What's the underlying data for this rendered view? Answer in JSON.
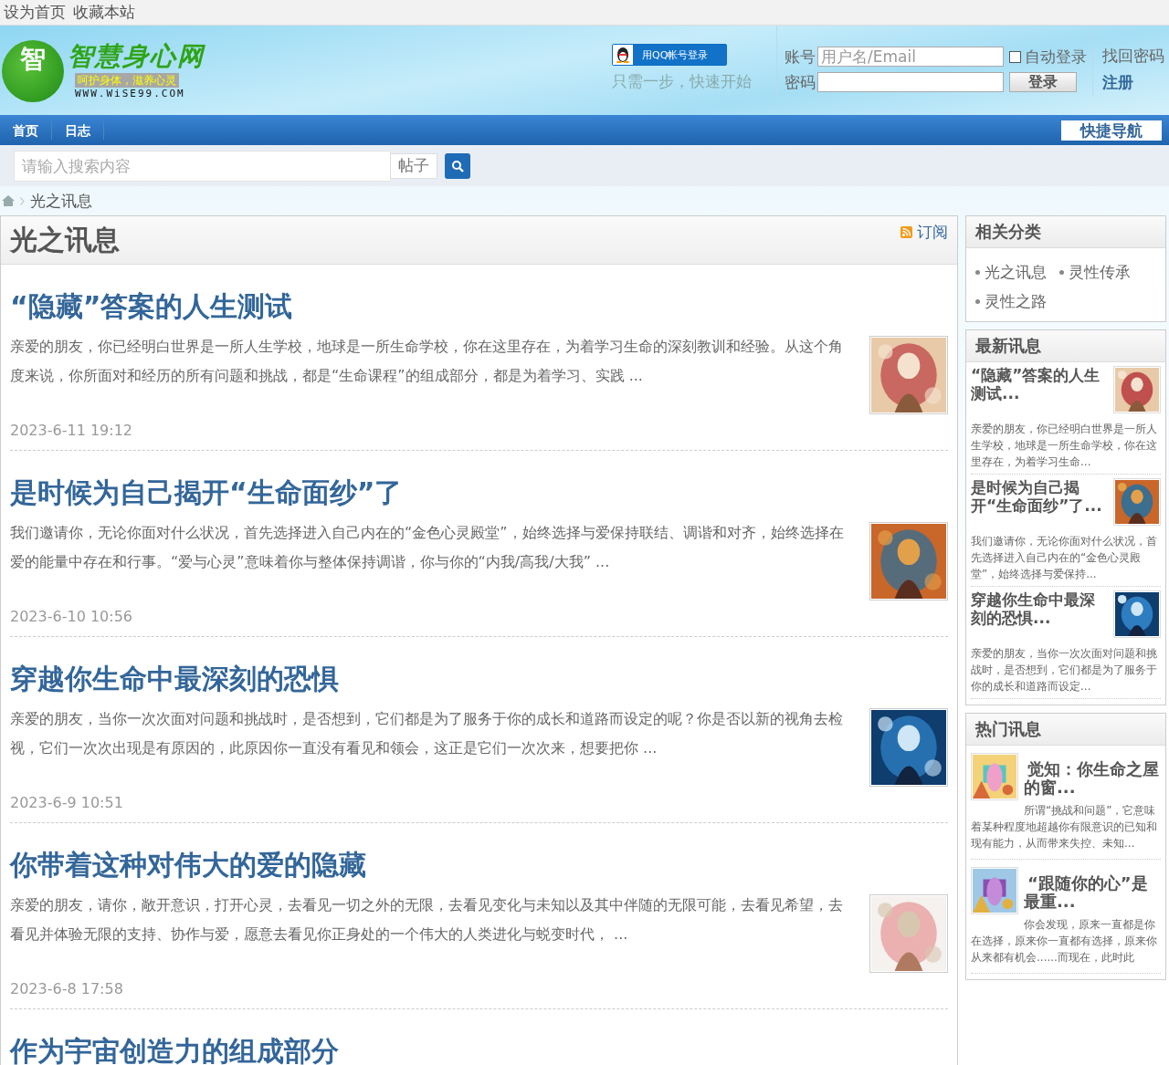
{
  "top_links": [
    "设为首页",
    "收藏本站"
  ],
  "logo": {
    "mark": "智",
    "name": "智慧身心网",
    "slogan": "呵护身体，滋养心灵",
    "url": "WWW.WiSE99.COM"
  },
  "qq_login": {
    "button": "用QQ帐号登录",
    "hint": "只需一步，快速开始"
  },
  "login": {
    "account_label": "账号",
    "account_placeholder": "用户名/Email",
    "password_label": "密码",
    "auto_login": "自动登录",
    "auto_login_checked": false,
    "submit": "登录",
    "forgot": "找回密码",
    "register": "注册"
  },
  "nav": {
    "items": [
      "首页",
      "日志"
    ],
    "quick_nav": "快捷导航"
  },
  "search": {
    "placeholder": "请输入搜索内容",
    "type": "帖子"
  },
  "breadcrumb": [
    "光之讯息"
  ],
  "main": {
    "title": "光之讯息",
    "subscribe": "订阅",
    "articles": [
      {
        "title": "“隐藏”答案的人生测试",
        "excerpt": "亲爱的朋友，你已经明白世界是一所人生学校，地球是一所生命学校，你在这里存在，为着学习生命的深刻教训和经验。从这个角度来说，你所面对和经历的所有问题和挑战，都是“生命课程”的组成部分，都是为着学习、实践 ...",
        "date": "2023-6-11 19:12"
      },
      {
        "title": "是时候为自己揭开“生命面纱”了",
        "excerpt": "我们邀请你，无论你面对什么状况，首先选择进入自己内在的“金色心灵殿堂”，始终选择与爱保持联结、调谐和对齐，始终选择在爱的能量中存在和行事。“爱与心灵”意味着你与整体保持调谐，你与你的“内我/高我/大我” ...",
        "date": "2023-6-10 10:56"
      },
      {
        "title": "穿越你生命中最深刻的恐惧",
        "excerpt": "亲爱的朋友，当你一次次面对问题和挑战时，是否想到，它们都是为了服务于你的成长和道路而设定的呢？你是否以新的视角去检视，它们一次次出现是有原因的，此原因你一直没有看见和领会，这正是它们一次次来，想要把你 ...",
        "date": "2023-6-9 10:51"
      },
      {
        "title": "你带着这种对伟大的爱的隐藏",
        "excerpt": "亲爱的朋友，请你，敞开意识，打开心灵，去看见一切之外的无限，去看见变化与未知以及其中伴随的无限可能，去看见希望，去看见并体验无限的支持、协作与爱，愿意去看见你正身处的一个伟大的人类进化与蜕变时代，  ...",
        "date": "2023-6-8 17:58"
      },
      {
        "title": "作为宇宙创造力的组成部分"
      }
    ]
  },
  "sidebar": {
    "related": {
      "title": "相关分类",
      "items": [
        "光之讯息",
        "灵性传承",
        "灵性之路"
      ]
    },
    "latest": {
      "title": "最新讯息",
      "items": [
        {
          "title": "“隐藏”答案的人生测试...",
          "excerpt": "亲爱的朋友，你已经明白世界是一所人生学校，地球是一所生命学校，你在这里存在，为着学习生命..."
        },
        {
          "title": "是时候为自己揭开“生命面纱”了...",
          "excerpt": "我们邀请你，无论你面对什么状况，首先选择进入自己内在的“金色心灵殿堂”，始终选择与爱保持..."
        },
        {
          "title": "穿越你生命中最深刻的恐惧...",
          "excerpt": "亲爱的朋友，当你一次次面对问题和挑战时，是否想到，它们都是为了服务于你的成长和道路而设定..."
        }
      ]
    },
    "hot": {
      "title": "热门讯息",
      "items": [
        {
          "title": "觉知：你生命之屋的窗...",
          "excerpt": "所谓“挑战和问题”，它意味着某种程度地超越你有限意识的已知和现有能力，从而带来失控、未知..."
        },
        {
          "title": "“跟随你的心”是最重...",
          "excerpt": "你会发现，原来一直都是你在选择，原来你一直都有选择，原来你从来都有机会......而现在，此时此"
        }
      ]
    }
  }
}
